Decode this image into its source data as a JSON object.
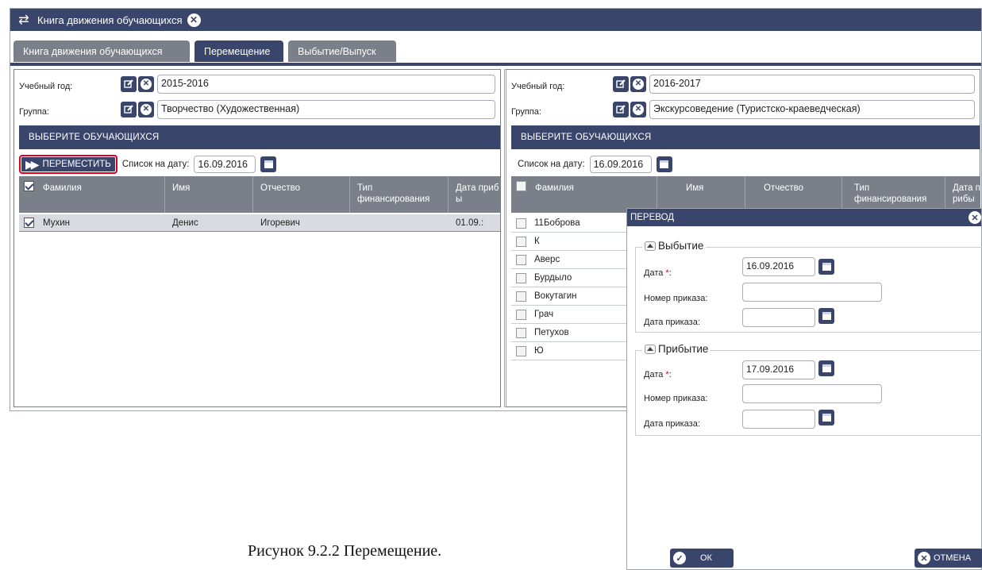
{
  "window": {
    "title": "Книга движения обучающихся"
  },
  "tabs": [
    "Книга движения обучающихся",
    "Перемещение",
    "Выбытие/Выпуск"
  ],
  "left": {
    "year_label": "Учебный год:",
    "year_value": "2015-2016",
    "group_label": "Группа:",
    "group_value": "Творчество (Художественная)",
    "header": "ВЫБЕРИТЕ ОБУЧАЮЩИХСЯ",
    "move_button": "ПЕРЕМЕСТИТЬ",
    "date_label": "Список на дату:",
    "date_value": "16.09.2016",
    "columns": [
      "Фамилия",
      "Имя",
      "Отчество",
      "Тип финансирования",
      "Дата прибы"
    ],
    "rows": [
      {
        "surname": "Мухин",
        "name": "Денис",
        "patronymic": "Игоревич",
        "funding": "",
        "date": "01.09.:"
      }
    ]
  },
  "right": {
    "year_label": "Учебный год:",
    "year_value": "2016-2017",
    "group_label": "Группа:",
    "group_value": "Экскурсоведение (Туристско-краеведческая)",
    "header": "ВЫБЕРИТЕ ОБУЧАЮЩИХСЯ",
    "date_label": "Список на дату:",
    "date_value": "16.09.2016",
    "columns": [
      "Фамилия",
      "Имя",
      "Отчество",
      "Тип финансирования",
      "Дата прибы"
    ],
    "rows": [
      "11Боброва",
      "К",
      "Аверс",
      "Бурдыло",
      "Вокутагин",
      "Грач",
      "Петухов",
      "Ю"
    ]
  },
  "dialog": {
    "title": "ПЕРЕВОД",
    "section1": "Выбытие",
    "section2": "Прибытие",
    "date_label": "Дата",
    "req": "*",
    "colon": ":",
    "order_num_label": "Номер приказа:",
    "order_date_label": "Дата приказа:",
    "departure_date": "16.09.2016",
    "arrival_date": "17.09.2016",
    "ok": "ОК",
    "cancel": "ОТМЕНА"
  },
  "caption": "Рисунок 9.2.2  Перемещение."
}
